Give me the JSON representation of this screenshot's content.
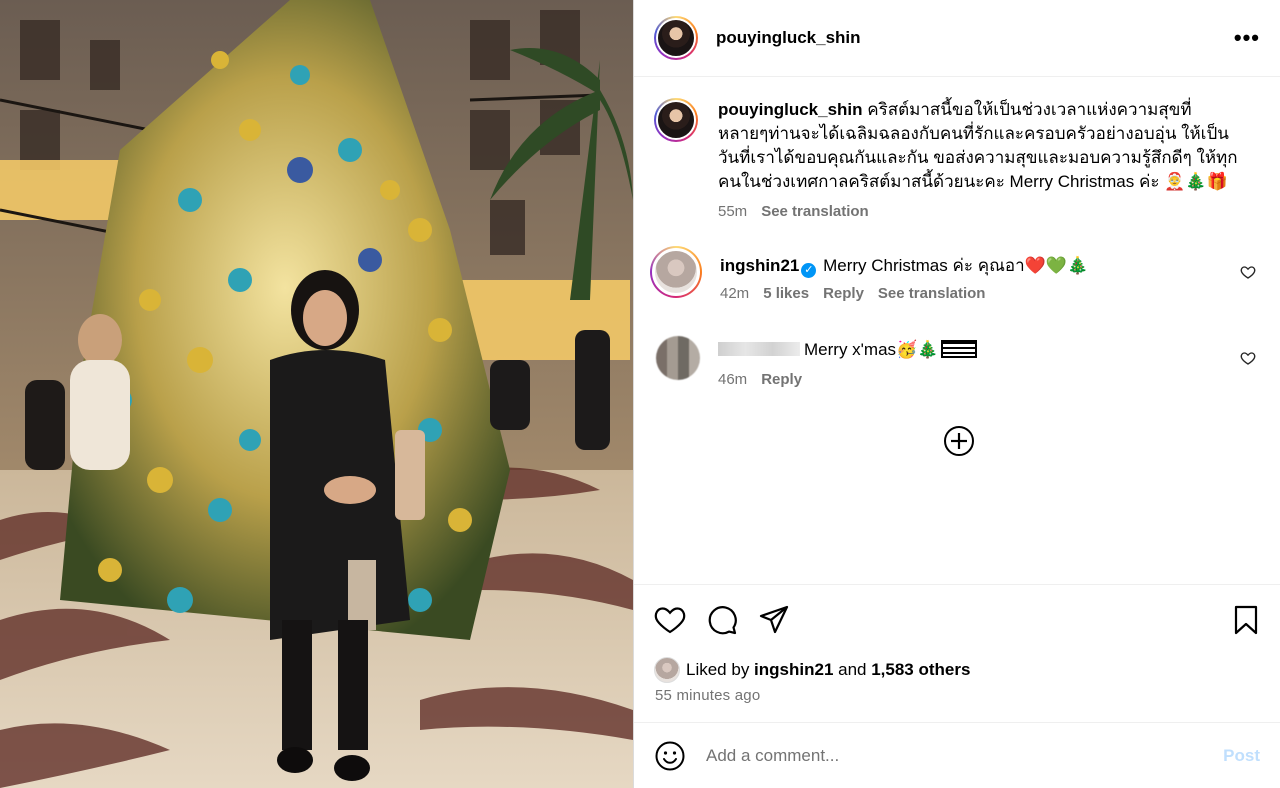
{
  "post": {
    "author": "pouyingluck_shin",
    "more_icon": "more-horizontal-icon",
    "caption": {
      "username": "pouyingluck_shin",
      "lines": [
        "คริสต์มาสนี้ขอให้เป็นช่วงเวลาแห่งความสุขที่",
        "หลายๆท่านจะได้เฉลิมฉลองกับคนที่รักและครอบครัวอย่างอบอุ่น ให้เป็น",
        "วันที่เราได้ขอบคุณกันและกัน ขอส่งความสุขและมอบความรู้สึกดีๆ ให้ทุก",
        "คนในช่วงเทศกาลคริสต์มาสนี้ด้วยนะคะ Merry Christmas ค่ะ 🤶🎄🎁"
      ],
      "time": "55m",
      "see_translation": "See translation"
    }
  },
  "comments": [
    {
      "username": "ingshin21",
      "verified": true,
      "text": "Merry Christmas ค่ะ คุณอา❤️💚🎄",
      "time": "42m",
      "likes": "5 likes",
      "reply": "Reply",
      "see_translation": "See translation"
    },
    {
      "username": "",
      "text": "Merry x'mas🥳🎄",
      "time": "46m",
      "reply": "Reply"
    }
  ],
  "actions": {
    "icons": [
      "heart-icon",
      "comment-icon",
      "share-icon",
      "bookmark-icon"
    ],
    "liked_by_prefix": "Liked by ",
    "liked_by_user": "ingshin21",
    "liked_by_mid": " and ",
    "liked_by_others": "1,583 others",
    "time_ago": "55 minutes ago"
  },
  "comment_input": {
    "placeholder": "Add a comment...",
    "post_label": "Post"
  },
  "colors": {
    "link_blue": "#0095f6",
    "post_disabled": "#c0dffd",
    "muted_text": "#737373"
  }
}
